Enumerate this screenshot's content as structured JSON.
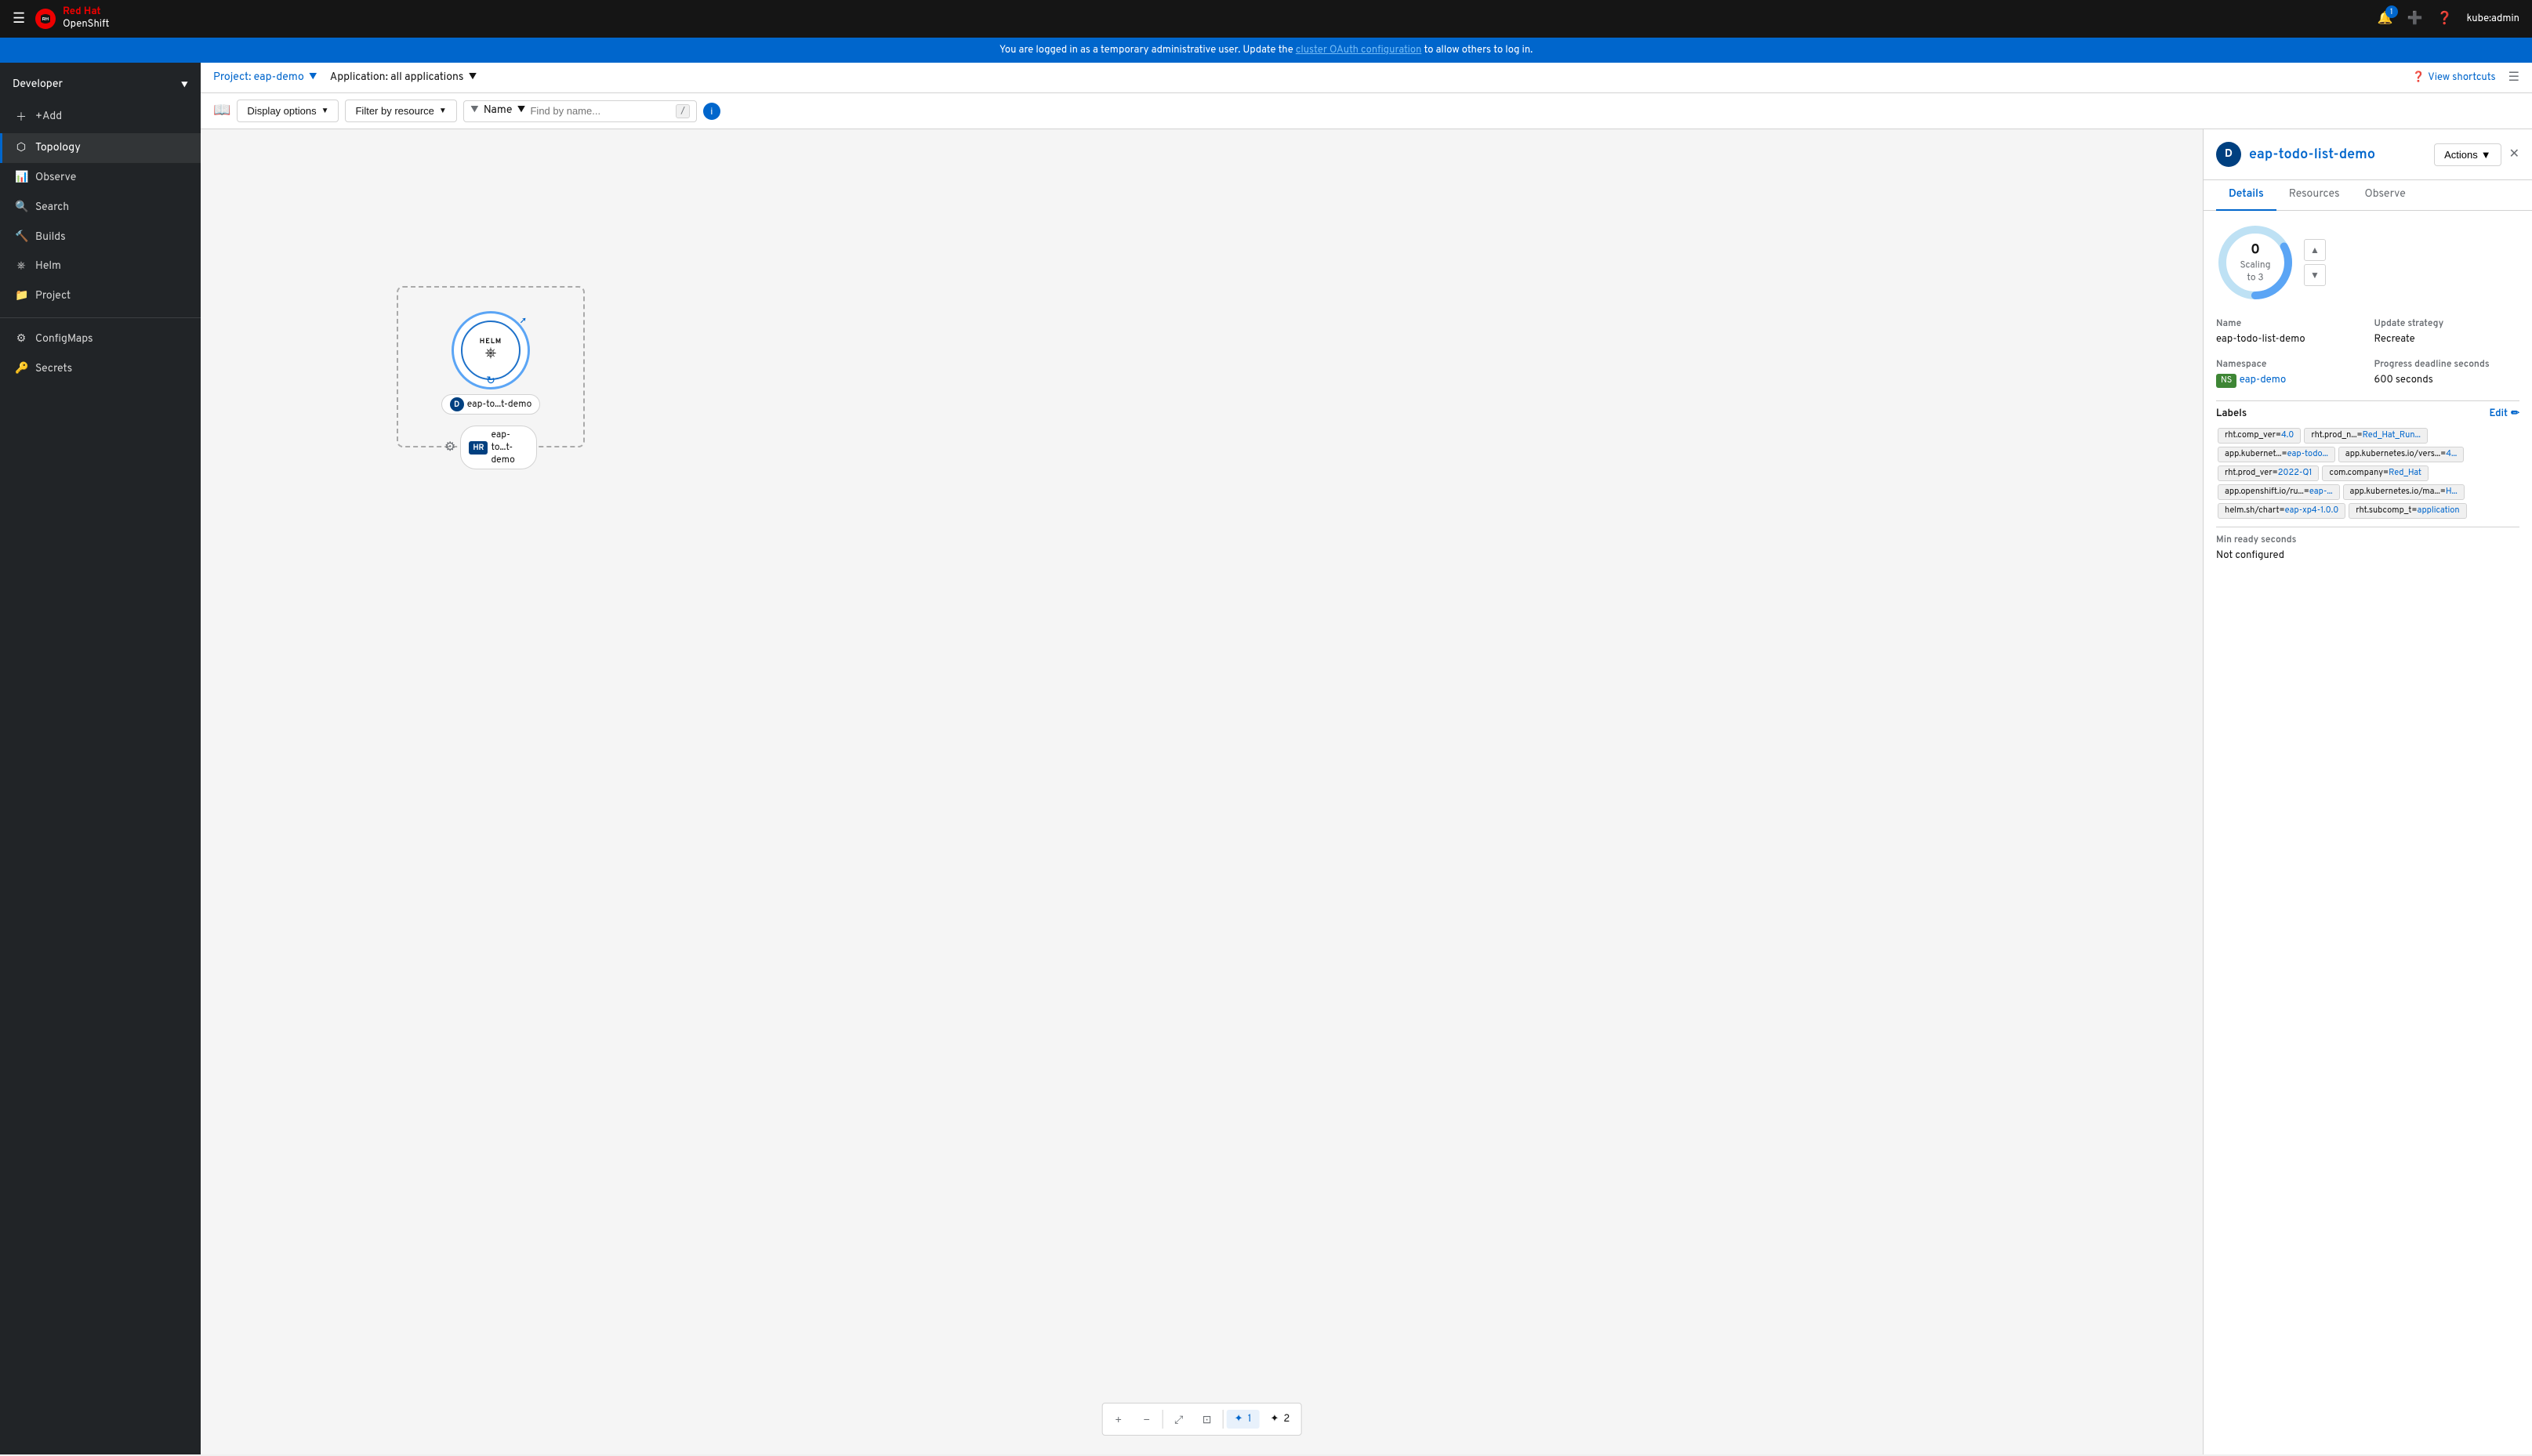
{
  "topnav": {
    "hamburger_label": "☰",
    "brand_red": "Red Hat",
    "brand_sub": "OpenShift",
    "notification_count": "1",
    "user": "kube:admin"
  },
  "banner": {
    "text": "You are logged in as a temporary administrative user. Update the ",
    "link_text": "cluster OAuth configuration",
    "text_after": " to allow others to log in."
  },
  "sidebar": {
    "perspective_label": "Developer",
    "items": [
      {
        "id": "add",
        "label": "+Add",
        "active": false
      },
      {
        "id": "topology",
        "label": "Topology",
        "active": true
      },
      {
        "id": "observe",
        "label": "Observe",
        "active": false
      },
      {
        "id": "search",
        "label": "Search",
        "active": false
      },
      {
        "id": "builds",
        "label": "Builds",
        "active": false
      },
      {
        "id": "helm",
        "label": "Helm",
        "active": false
      },
      {
        "id": "project",
        "label": "Project",
        "active": false
      },
      {
        "id": "configmaps",
        "label": "ConfigMaps",
        "active": false
      },
      {
        "id": "secrets",
        "label": "Secrets",
        "active": false
      }
    ]
  },
  "projectbar": {
    "project_label": "Project: eap-demo",
    "app_label": "Application: all applications",
    "view_shortcuts": "View shortcuts"
  },
  "toolbar": {
    "display_options": "Display options",
    "filter_by_resource": "Filter by resource",
    "filter_name_label": "Name",
    "find_placeholder": "Find by name...",
    "keyboard_shortcut": "/"
  },
  "topology": {
    "node_label": "eap-to...t-demo",
    "node_release": "eap-to...t-demo",
    "helm_text": "HELM"
  },
  "zoom_controls": {
    "zoom_in": "−",
    "zoom_out": "+",
    "fit": "⤡",
    "reset": "⊡",
    "option1_icon": "✦",
    "option1_label": "1",
    "option2_icon": "✦",
    "option2_label": "2"
  },
  "rightpanel": {
    "icon_letter": "D",
    "title": "eap-todo-list-demo",
    "close": "✕",
    "actions_label": "Actions",
    "tabs": [
      "Details",
      "Resources",
      "Observe"
    ],
    "active_tab": "Details",
    "scaling": {
      "count": "0",
      "label": "Scaling to 3"
    },
    "details": {
      "name_label": "Name",
      "name_value": "eap-todo-list-demo",
      "update_strategy_label": "Update strategy",
      "update_strategy_value": "Recreate",
      "namespace_label": "Namespace",
      "namespace_value": "eap-demo",
      "progress_deadline_label": "Progress deadline seconds",
      "progress_deadline_value": "600 seconds",
      "labels_label": "Labels",
      "edit_label": "Edit",
      "min_ready_label": "Min ready seconds",
      "min_ready_value": "Not configured"
    },
    "labels": [
      "rht.comp_ver=4.0",
      "rht.prod_n...=Red_Hat_Run...",
      "app.kubernet...=eap-todo...",
      "app.kubernetes.io/vers...=4...",
      "rht.prod_ver=2022-Q1",
      "com.company=Red_Hat",
      "app.openshift.io/ru...=eap-...",
      "app.kubernetes.io/ma...=H...",
      "helm.sh/chart=eap-xp4-1.0.0",
      "rht.subcomp_t=application"
    ]
  }
}
